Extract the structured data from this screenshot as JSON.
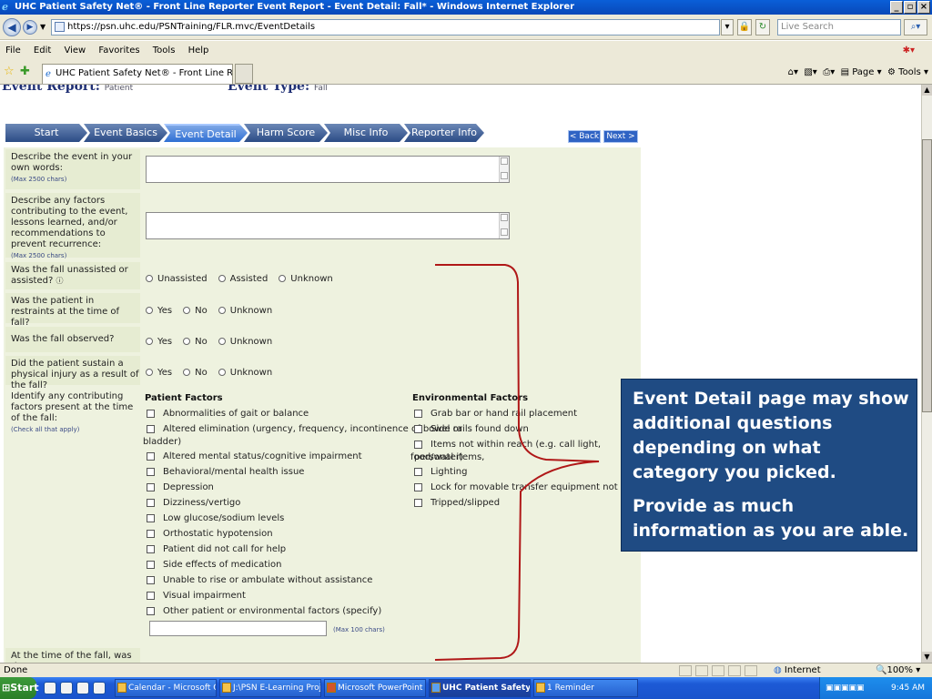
{
  "window": {
    "title": "UHC Patient Safety Net® - Front Line Reporter Event Report - Event Detail: Fall* - Windows Internet Explorer"
  },
  "browser": {
    "url": "https://psn.uhc.edu/PSNTraining/FLR.mvc/EventDetails",
    "search_placeholder": "Live Search",
    "menu": [
      "File",
      "Edit",
      "View",
      "Favorites",
      "Tools",
      "Help"
    ],
    "tab_label": "UHC Patient Safety Net® - Front Line Reporter Event...",
    "cmd_page": "Page",
    "cmd_tools": "Tools"
  },
  "page": {
    "event_report_label": "Event Report:",
    "event_report_value": "Patient",
    "event_type_label": "Event Type:",
    "event_type_value": "Fall",
    "steps": [
      "Start",
      "Event Basics",
      "Event Detail",
      "Harm Score",
      "Misc Info",
      "Reporter Info"
    ],
    "back_label": "< Back",
    "next_label": "Next >"
  },
  "form": {
    "q1": {
      "label": "Describe the event in your own words:",
      "hint": "(Max 2500 chars)"
    },
    "q2": {
      "label": "Describe any factors contributing to the event, lessons learned, and/or recommendations to prevent recurrence:",
      "hint": "(Max 2500 chars)"
    },
    "q3": {
      "label": "Was the fall unassisted or assisted?",
      "options": [
        "Unassisted",
        "Assisted",
        "Unknown"
      ]
    },
    "q4": {
      "label": "Was the patient in restraints at the time of fall?",
      "options": [
        "Yes",
        "No",
        "Unknown"
      ]
    },
    "q5": {
      "label": "Was the fall observed?",
      "options": [
        "Yes",
        "No",
        "Unknown"
      ]
    },
    "q6": {
      "label": "Did the patient sustain a physical injury as a result of the fall?",
      "options": [
        "Yes",
        "No",
        "Unknown"
      ]
    },
    "q7": {
      "label": "Identify any contributing factors present at the time of the fall:",
      "hint": "(Check all that apply)",
      "patient_header": "Patient Factors",
      "patient_factors": [
        "Abnormalities of gait or balance",
        "Altered elimination (urgency, frequency, incontinence of bowel or",
        "bladder)",
        "Altered mental status/cognitive impairment",
        "Behavioral/mental health issue",
        "Depression",
        "Dizziness/vertigo",
        "Low glucose/sodium levels",
        "Orthostatic hypotension",
        "Patient did not call for help",
        "Side effects of medication",
        "Unable to rise or ambulate without assistance",
        "Visual impairment",
        "Other patient or environmental factors (specify)"
      ],
      "other_hint": "(Max 100 chars)",
      "env_header": "Environmental Factors",
      "env_factors": [
        "Grab bar or hand rail placement",
        "Side rails found down",
        "Items not within reach (e.g. call light, personal items,",
        "food/water)",
        "Lighting",
        "Lock for movable transfer equipment not set",
        "Tripped/slipped"
      ]
    },
    "q8": {
      "label": "At the time of the fall, was the"
    }
  },
  "callout": {
    "line1": "Event Detail page may show additional questions depending on what category you picked.",
    "line2": "Provide as much information as you are able."
  },
  "status": {
    "left": "Done",
    "zone": "Internet",
    "zoom": "100%"
  },
  "taskbar": {
    "start": "Start",
    "tasks": [
      "Calendar - Microsoft Outl...",
      "J:\\PSN E-Learning Projec...",
      "Microsoft PowerPoint - [L...",
      "UHC Patient Safety N...",
      "1 Reminder"
    ],
    "time": "9:45 AM"
  },
  "colors": {
    "form_bg": "#eef2df",
    "step_blue": "#2b4b85",
    "callout_bg": "#1f4b83",
    "bracket": "#b01818"
  }
}
